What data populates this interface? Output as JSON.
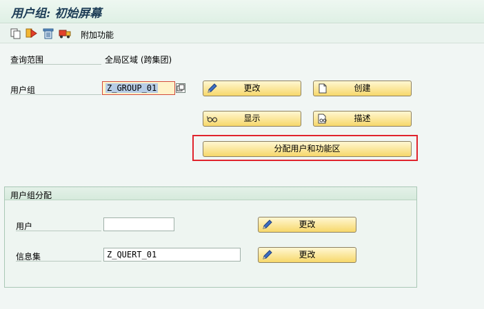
{
  "title": "用户组: 初始屏幕",
  "toolbar": {
    "icons": [
      "copy-icon",
      "execute-icon",
      "delete-icon",
      "transport-icon"
    ],
    "extra_functions_label": "附加功能"
  },
  "scope": {
    "label": "查询范围",
    "value": "全局区域 (跨集团)"
  },
  "user_group": {
    "label": "用户组",
    "value": "Z_GROUP_01"
  },
  "buttons": {
    "change": "更改",
    "create": "创建",
    "display": "显示",
    "describe": "描述",
    "assign": "分配用户和功能区"
  },
  "assignment": {
    "title": "用户组分配",
    "user_label": "用户",
    "user_value": "",
    "infoset_label": "信息集",
    "infoset_value": "Z_QUERT_01",
    "change_label": "更改"
  },
  "colors": {
    "button_gradient_top": "#fff7d2",
    "button_gradient_bottom": "#f7d86b",
    "highlight_frame": "#e0232c",
    "title_color": "#1c3c56"
  }
}
